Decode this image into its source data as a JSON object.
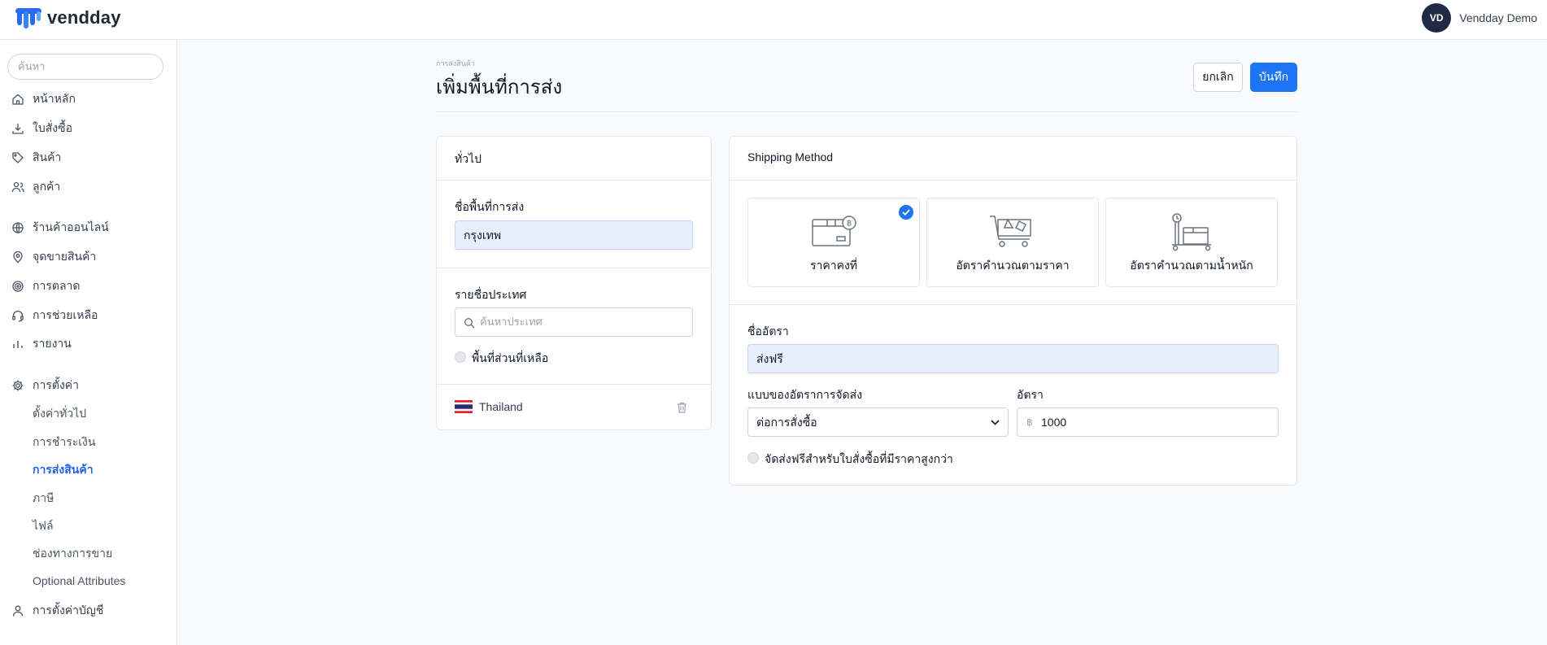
{
  "app": {
    "name": "vendday"
  },
  "user": {
    "initials": "VD",
    "name": "Vendday Demo"
  },
  "sidebar": {
    "search_placeholder": "ค้นหา",
    "items": [
      {
        "label": "หน้าหลัก",
        "icon": "home-icon"
      },
      {
        "label": "ใบสั่งซื้อ",
        "icon": "download-icon"
      },
      {
        "label": "สินค้า",
        "icon": "tag-icon"
      },
      {
        "label": "ลูกค้า",
        "icon": "users-icon"
      },
      {
        "label": "ร้านค้าออนไลน์",
        "icon": "globe-icon"
      },
      {
        "label": "จุดขายสินค้า",
        "icon": "map-pin-icon"
      },
      {
        "label": "การตลาด",
        "icon": "target-icon"
      },
      {
        "label": "การช่วยเหลือ",
        "icon": "headset-icon"
      },
      {
        "label": "รายงาน",
        "icon": "bar-chart-icon"
      },
      {
        "label": "การตั้งค่า",
        "icon": "gear-icon"
      }
    ],
    "sub_items": [
      {
        "label": "ตั้งค่าทั่วไป",
        "active": false
      },
      {
        "label": "การชำระเงิน",
        "active": false
      },
      {
        "label": "การส่งสินค้า",
        "active": true
      },
      {
        "label": "ภาษี",
        "active": false
      },
      {
        "label": "ไฟล์",
        "active": false
      },
      {
        "label": "ช่องทางการขาย",
        "active": false
      },
      {
        "label": "Optional Attributes",
        "active": false
      }
    ],
    "account_settings": {
      "label": "การตั้งค่าบัญชี",
      "icon": "user-icon"
    }
  },
  "page": {
    "breadcrumb": "การส่งสินค้า",
    "title": "เพิ่มพื้นที่การส่ง",
    "cancel_label": "ยกเลิก",
    "save_label": "บันทึก"
  },
  "general_card": {
    "title": "ทั่วไป",
    "zone_name_label": "ชื่อพื้นที่การส่ง",
    "zone_name_value": "กรุงเทพ",
    "country_list_label": "รายชื่อประเทศ",
    "country_search_placeholder": "ค้นหาประเทศ",
    "rest_of_world_label": "พื้นที่ส่วนที่เหลือ",
    "country": {
      "name": "Thailand",
      "flag": "thailand-flag-icon"
    }
  },
  "shipping_card": {
    "title": "Shipping Method",
    "methods": [
      {
        "label": "ราคาคงที่",
        "icon": "fixed-price-box-icon",
        "selected": true
      },
      {
        "label": "อัตราคำนวณตามราคา",
        "icon": "cart-price-icon",
        "selected": false
      },
      {
        "label": "อัตราคำนวณตามน้ำหนัก",
        "icon": "weight-scale-icon",
        "selected": false
      }
    ],
    "rate_name_label": "ชื่ออัตรา",
    "rate_name_value": "ส่งฟรี",
    "rate_type_label": "แบบของอัตราการจัดส่ง",
    "rate_type_value": "ต่อการสั่งซื้อ",
    "rate_label": "อัตรา",
    "currency_symbol": "฿",
    "rate_value": "1000",
    "free_shipping_label": "จัดส่งฟรีสำหรับใบสั่งซื้อที่มีราคาสูงกว่า"
  },
  "colors": {
    "primary": "#1d74f5",
    "active_nav": "#2563eb",
    "avatar_bg": "#1f2a44"
  }
}
